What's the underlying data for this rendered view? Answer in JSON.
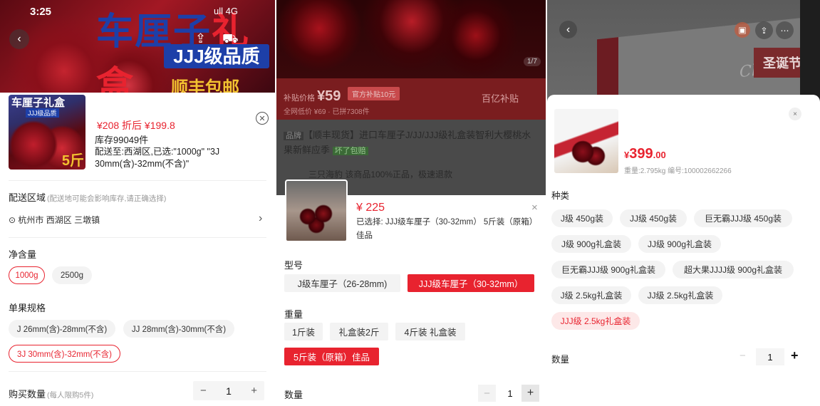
{
  "panel1": {
    "status": {
      "time": "3:25",
      "signal": "ull 4G"
    },
    "banner": {
      "headline_main": "车厘子",
      "headline_red": "礼盒",
      "sub": "JJJ级品质",
      "shipping": "顺丰包邮"
    },
    "thumb": {
      "title": "车厘子礼盒",
      "badge": "JJJ级品质",
      "weight": "5斤"
    },
    "price_text": "¥208  折后 ¥199.8",
    "stock": "库存99049件",
    "selection": "配送至:西湖区,已选:\"1000g\" \"3J 30mm(含)-32mm(不含)\"",
    "delivery": {
      "label": "配送区域",
      "hint": "(配送地可能会影响库存,请正确选择)",
      "address": "杭州市 西湖区 三墩镇"
    },
    "net_weight": {
      "label": "净含量",
      "options": [
        "1000g",
        "2500g"
      ],
      "selected": 0
    },
    "fruit_spec": {
      "label": "单果规格",
      "options": [
        "J 26mm(含)-28mm(不含)",
        "JJ 28mm(含)-30mm(不含)",
        "3J 30mm(含)-32mm(不含)"
      ],
      "selected": 2
    },
    "quantity": {
      "label": "购买数量",
      "hint": "(每人限购5件)",
      "value": "1",
      "minus": "−",
      "plus": "+"
    }
  },
  "panel2": {
    "image_counter": "1/7",
    "subsidy_label": "补贴价格",
    "subsidy_price": "¥59",
    "subsidy_tag": "官方补贴10元",
    "original": "全网低价 ¥69 · 已拼7308件",
    "right_label": "百亿补贴",
    "brand_tag": "品牌",
    "title": "【顺丰现货】进口车厘子J/JJ/JJJ级礼盒装智利大樱桃水果新鲜应季",
    "free_tag": "坏了包赔",
    "shop": "三只海豹  该商品100%正品，极速退款",
    "price": "¥ 225",
    "selection": "已选择: JJJ级车厘子（30-32mm） 5斤装（原箱）佳品",
    "close": "×",
    "model": {
      "label": "型号",
      "options": [
        "J级车厘子（26-28mm)",
        "JJJ级车厘子（30-32mm）"
      ],
      "selected": 1
    },
    "weight": {
      "label": "重量",
      "options": [
        "1斤装",
        "礼盒装2斤",
        "4斤装 礼盒装",
        "5斤装（原箱）佳品"
      ],
      "selected": 3
    },
    "quantity": {
      "label": "数量",
      "value": "1",
      "minus": "−",
      "plus": "+"
    }
  },
  "panel3": {
    "xmas": "圣诞节",
    "box_text": "Cherries",
    "price": {
      "symbol": "¥",
      "integer": "399",
      "decimal": ".00"
    },
    "meta": "重量:2.795kg  编号:100002662266",
    "close": "×",
    "type": {
      "label": "种类",
      "options": [
        "J级 450g装",
        "JJ级 450g装",
        "巨无霸JJJ级 450g装",
        "J级 900g礼盒装",
        "JJ级 900g礼盒装",
        "巨无霸JJJ级 900g礼盒装",
        "超大果JJJJ级 900g礼盒装",
        "J级 2.5kg礼盒装",
        "JJ级 2.5kg礼盒装",
        "JJJ级 2.5kg礼盒装"
      ],
      "selected": 9
    },
    "quantity": {
      "label": "数量",
      "value": "1",
      "minus": "−",
      "plus": "+"
    }
  },
  "colors": {
    "accent_red": "#e8232f",
    "chip_bg": "#f3f3f3",
    "brand_blue": "#1d3fa8"
  }
}
